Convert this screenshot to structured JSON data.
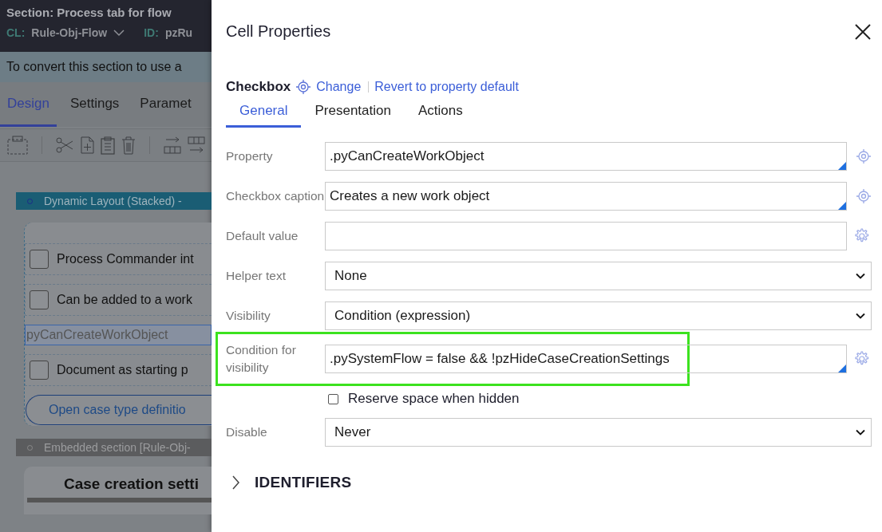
{
  "background": {
    "title": "Section: Process tab for flow",
    "class_label": "CL:",
    "class_value": "Rule-Obj-Flow",
    "id_label": "ID:",
    "id_value": "pzRu",
    "notice": "To convert this section to use a",
    "tabs": [
      {
        "label": "Design",
        "selected": true
      },
      {
        "label": "Settings",
        "selected": false
      },
      {
        "label": "Paramet",
        "selected": false
      }
    ],
    "layout_title": "Dynamic Layout (Stacked) -",
    "items": [
      {
        "kind": "checkbox",
        "label": "Process Commander int",
        "checked": false
      },
      {
        "kind": "checkbox",
        "label": "Can be added to a work",
        "checked": false
      },
      {
        "kind": "field",
        "value": "pyCanCreateWorkObject",
        "selected": true
      },
      {
        "kind": "checkbox",
        "label": "Document as starting p",
        "checked": false
      },
      {
        "kind": "button",
        "label": "Open case type definitio"
      }
    ],
    "embedded_title": "Embedded section [Rule-Obj-",
    "card_heading": "Case creation setti"
  },
  "panel": {
    "title": "Cell Properties",
    "control": {
      "type": "Checkbox",
      "links": [
        "Change",
        "Revert to property default"
      ]
    },
    "tabs": [
      {
        "label": "General",
        "selected": true
      },
      {
        "label": "Presentation",
        "selected": false
      },
      {
        "label": "Actions",
        "selected": false
      }
    ],
    "fields": [
      {
        "kind": "property",
        "label": "Property",
        "value": ".pyCanCreateWorkObject",
        "autocomplete": true,
        "highlighted": false
      },
      {
        "kind": "property",
        "label": "Checkbox caption",
        "value": "Creates a new work object",
        "autocomplete": true,
        "highlighted": false
      },
      {
        "kind": "text",
        "label": "Default value",
        "autocomplete": false,
        "highlighted": false
      },
      {
        "kind": "select",
        "label": "Helper text",
        "value": "None",
        "highlighted": false
      },
      {
        "kind": "select",
        "label": "Visibility",
        "value": "Condition (expression)",
        "highlighted": false
      },
      {
        "kind": "text",
        "label": "Condition for visibility",
        "value": ".pySystemFlow = false && !pzHideCaseCreationSettings",
        "autocomplete": true,
        "highlighted": true
      },
      {
        "kind": "checkbox",
        "label": "Reserve space when hidden",
        "checked": false
      },
      {
        "kind": "select",
        "label": "Disable",
        "value": "Never",
        "highlighted": false
      }
    ],
    "sections": [
      {
        "title": "IDENTIFIERS",
        "expanded": false
      }
    ]
  }
}
